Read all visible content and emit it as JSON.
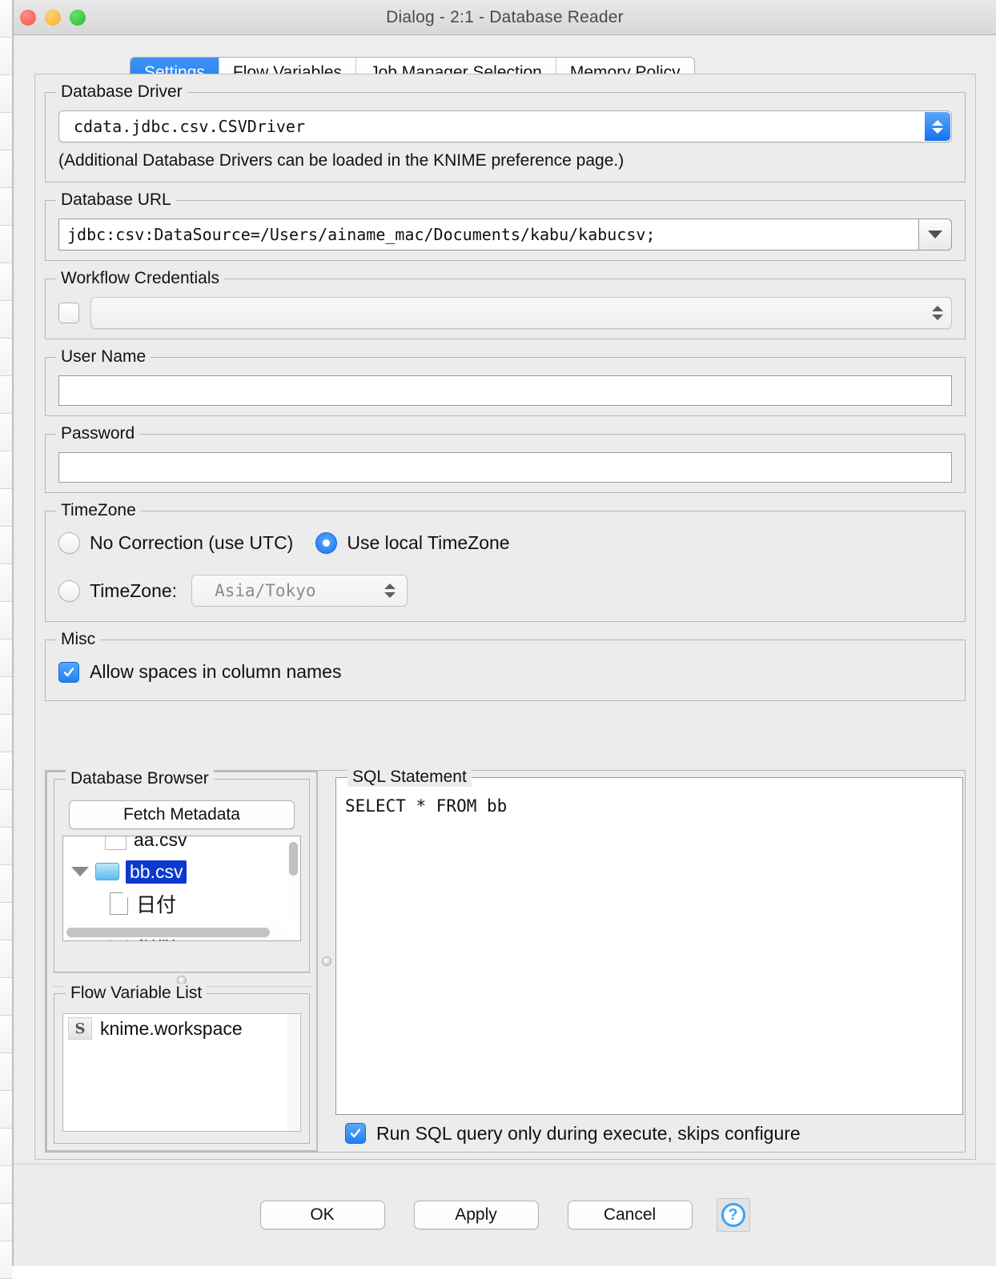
{
  "window": {
    "title": "Dialog - 2:1 - Database Reader",
    "traffic_lights": [
      "close-button",
      "minimize-button",
      "zoom-button"
    ]
  },
  "tabs": [
    {
      "label": "Settings",
      "active": true
    },
    {
      "label": "Flow Variables",
      "active": false
    },
    {
      "label": "Job Manager Selection",
      "active": false
    },
    {
      "label": "Memory Policy",
      "active": false
    }
  ],
  "database_driver": {
    "legend": "Database Driver",
    "value": "cdata.jdbc.csv.CSVDriver",
    "hint": "(Additional Database Drivers can be loaded in the KNIME preference page.)"
  },
  "database_url": {
    "legend": "Database URL",
    "value": "jdbc:csv:DataSource=/Users/ainame_mac/Documents/kabu/kabucsv;"
  },
  "workflow_credentials": {
    "legend": "Workflow Credentials",
    "checked": false,
    "value": ""
  },
  "user_name": {
    "legend": "User Name",
    "value": "",
    "placeholder": ""
  },
  "password": {
    "legend": "Password",
    "value": "",
    "placeholder": ""
  },
  "timezone": {
    "legend": "TimeZone",
    "option_no_correction": "No Correction (use UTC)",
    "option_use_local": "Use local TimeZone",
    "option_timezone": "TimeZone:",
    "selected": "Use local TimeZone",
    "timezone_value": "Asia/Tokyo"
  },
  "misc": {
    "legend": "Misc",
    "allow_spaces_label": "Allow spaces in column names",
    "allow_spaces_checked": true
  },
  "database_browser": {
    "legend": "Database Browser",
    "fetch_button": "Fetch Metadata",
    "tree": [
      {
        "label": "aa.csv",
        "icon": "empty-checkbox-icon",
        "depth": 1,
        "selected": false,
        "partial": true
      },
      {
        "label": "bb.csv",
        "icon": "folder-icon",
        "depth": 0,
        "selected": true,
        "expanded": true
      },
      {
        "label": "日付",
        "icon": "file-icon",
        "depth": 2,
        "selected": false
      },
      {
        "label": "始値",
        "icon": "file-icon",
        "depth": 2,
        "selected": false,
        "partial": true
      }
    ]
  },
  "flow_variable_list": {
    "legend": "Flow Variable List",
    "items": [
      {
        "label": "knime.workspace",
        "icon": "string-variable-icon"
      }
    ]
  },
  "sql_statement": {
    "legend": "SQL Statement",
    "value": "SELECT * FROM bb"
  },
  "run_option": {
    "label": "Run SQL query only during execute, skips configure",
    "checked": true
  },
  "footer": {
    "ok": "OK",
    "apply": "Apply",
    "cancel": "Cancel",
    "help": "?"
  },
  "colors": {
    "accent_blue": "#1d7ef2",
    "selection_blue": "#0b39d0",
    "panel_gray": "#ececec",
    "titlebar_gray": "#dedede",
    "help_blue": "#3da4f5"
  }
}
